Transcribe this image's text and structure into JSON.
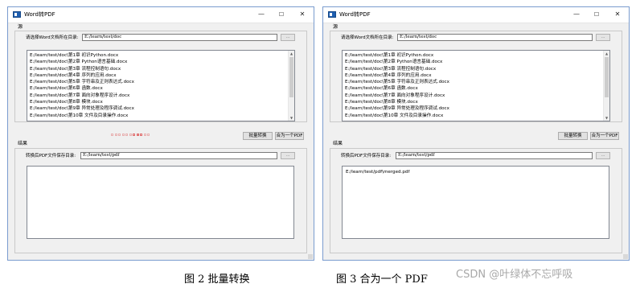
{
  "window_title": "Word转PDF",
  "window_controls": {
    "minimize": "—",
    "maximize": "☐",
    "close": "✕"
  },
  "source_group": {
    "label": "源",
    "dir_label": "请选择Word文档所在目录:",
    "dir_value": "E:/learn/test/doc",
    "browse_label": "...",
    "files": [
      "E:/learn/test/doc\\第1章  初识Python.docx",
      "E:/learn/test/doc\\第2章  Python语言基础.docx",
      "E:/learn/test/doc\\第3章  流程控制语句.docx",
      "E:/learn/test/doc\\第4章  序列的应用.docx",
      "E:/learn/test/doc\\第5章  字符串及正则表达式.docx",
      "E:/learn/test/doc\\第6章  函数.docx",
      "E:/learn/test/doc\\第7章  面向对象程序设计.docx",
      "E:/learn/test/doc\\第8章  模块.docx",
      "E:/learn/test/doc\\第9章  异常处理及程序调试.docx",
      "E:/learn/test/doc\\第10章  文件及目录操作.docx"
    ]
  },
  "actions": {
    "batch_label": "批量转换",
    "merge_label": "合为一个PDF"
  },
  "result_group": {
    "label": "结果",
    "dir_label": "转换后PDF文件保存目录:",
    "dir_value": "E:/learn/test/pdf",
    "browse_label": "..."
  },
  "left": {
    "result_text": ""
  },
  "right": {
    "result_text": "E:/learn/test/pdf\\merged.pdf"
  },
  "captions": {
    "left": "图 2    批量转换",
    "right": "图 3    合为一个 PDF"
  },
  "watermark": "CSDN @叶绿体不忘呼吸",
  "icons": {
    "app": "window-app-icon",
    "scroll_up": "scroll-up-icon",
    "scroll_down": "scroll-down-icon"
  },
  "colors": {
    "accent": "#1f5fb0",
    "progress": "#e06a6a",
    "window_bg": "#f0f0f0"
  }
}
